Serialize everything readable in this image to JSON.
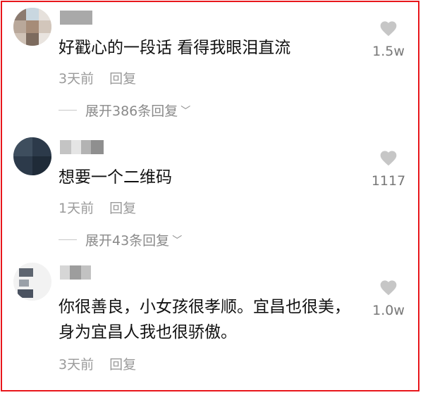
{
  "comments": [
    {
      "text": "好戳心的一段话 看得我眼泪直流",
      "time": "3天前",
      "reply_label": "回复",
      "expand_label": "展开386条回复",
      "likes": "1.5w"
    },
    {
      "text": "想要一个二维码",
      "time": "1天前",
      "reply_label": "回复",
      "expand_label": "展开43条回复",
      "likes": "1117"
    },
    {
      "text": "你很善良，小女孩很孝顺。宜昌也很美，身为宜昌人我也很骄傲。",
      "time": "3天前",
      "reply_label": "回复",
      "likes": "1.0w"
    }
  ],
  "icons": {
    "like": "heart-icon",
    "chevron": "chevron-down-icon"
  },
  "colors": {
    "border": "#e8161b",
    "text": "#111111",
    "muted": "#9a9a9a",
    "heart": "#c6c6c6"
  }
}
